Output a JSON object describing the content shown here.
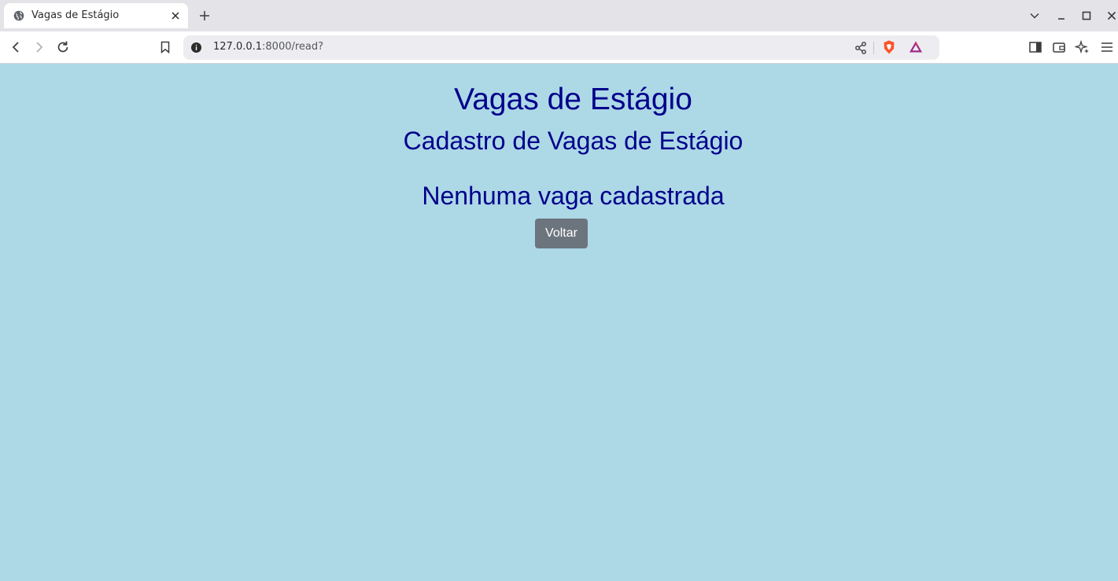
{
  "browser": {
    "tab": {
      "title": "Vagas de Estágio",
      "favicon": "globe-icon"
    },
    "address": {
      "host": "127.0.0.1",
      "path": ":8000/read?"
    }
  },
  "page": {
    "title": "Vagas de Estágio",
    "subtitle": "Cadastro de Vagas de Estágio",
    "empty_message": "Nenhuma vaga cadastrada",
    "back_button": "Voltar"
  },
  "colors": {
    "background": "#add8e6",
    "heading": "#00008b",
    "button": "#6c757d"
  }
}
